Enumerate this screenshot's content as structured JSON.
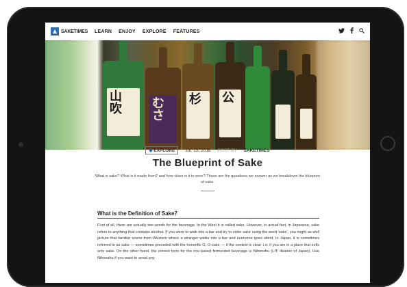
{
  "nav": {
    "logo_text": "SAKETIMES",
    "items": [
      "LEARN",
      "ENJOY",
      "EXPLORE",
      "FEATURES"
    ],
    "icons": [
      "twitter-icon",
      "facebook-icon",
      "search-icon"
    ]
  },
  "article": {
    "category": "EXPLORE",
    "date": "Jul. 15, 2016",
    "posted_by_label": "POST BY",
    "author": "SAKETIMES",
    "title": "The Blueprint of Sake",
    "lead": "What is sake? What is it made from? and how close is it to wine? Those are the questions we answer as we breakdown the blueprint of sake.",
    "section_heading": "What is the Definition of Sake？",
    "body": "First of all, there are actually two words for the beverage. In the West it is called sake. However, in actual fact, in Japanese, sake refers to anything that contains alcohol. If you were to walk into a bar and try to order sake using the word 'sake', you might as well picture that familiar scene from Western where a stranger walks into a bar and everyone goes silent. In Japan, it is sometimes referred to as sake — sometimes preceded with the honorific O, O-sake — if the context is clear: i.e. if you are in a place that sells only sake. On the other hand, the correct term for the rice-based fermented beverage is Nihonshu (LIT: libation of Japan). Use Nihonshu if you want to avoid any"
  },
  "colors": {
    "accent": "#2d6db3",
    "bezel": "#141414"
  }
}
